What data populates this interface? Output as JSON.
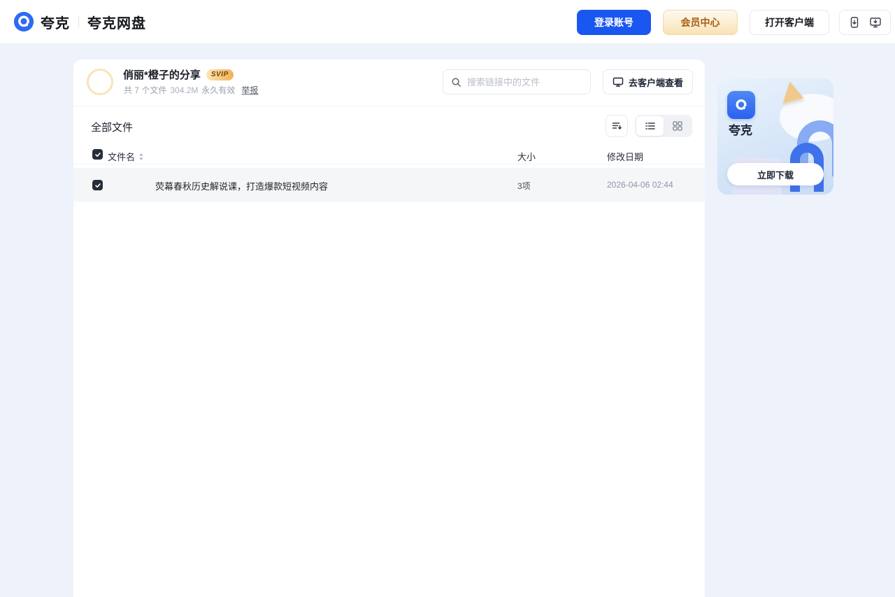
{
  "header": {
    "brand": "夸克",
    "product": "夸克网盘",
    "login_button": "登录账号",
    "vip_button": "会员中心",
    "client_button": "打开客户端"
  },
  "share": {
    "owner": "俏丽*橙子的分享",
    "badge": "SVIP",
    "meta_files": "共 7 个文件",
    "total_size": "304.2M",
    "validity": "永久有效",
    "report_link": "举报",
    "search_placeholder": "搜索链接中的文件",
    "open_client_button": "去客户端查看"
  },
  "file_list": {
    "section_title": "全部文件",
    "columns": {
      "name": "文件名",
      "size": "大小",
      "modified": "修改日期"
    },
    "rows": [
      {
        "name": "荧幕春秋历史解说课，打造爆款短视频内容",
        "size": "3项",
        "modified": "2026-04-06 02:44",
        "checked": true
      }
    ]
  },
  "promo": {
    "app_name": "夸克",
    "download_button": "立即下载"
  },
  "colors": {
    "accent_blue": "#1a56f0",
    "vip_gold_text": "#a35e15",
    "page_background": "#edf2fb",
    "selected_row": "#f5f6f8"
  }
}
